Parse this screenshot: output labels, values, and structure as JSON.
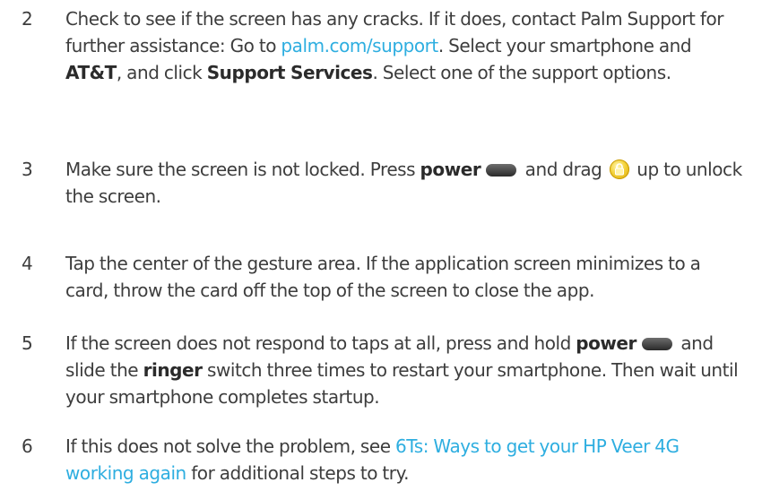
{
  "steps": [
    {
      "number": "2",
      "t1": "Check to see if the screen has any cracks. If it does, contact Palm Support for further assistance: Go to ",
      "link": "palm.com/support",
      "t2": ". Select your smartphone and ",
      "b1": "AT&T",
      "t3": ", and click ",
      "b2": "Support Services",
      "t4": ". Select one of the support options."
    },
    {
      "number": "3",
      "t1": "Make sure the screen is not locked. Press ",
      "b1": "power",
      "t2": " and drag ",
      "t3": " up to unlock the screen."
    },
    {
      "number": "4",
      "t1": "Tap the center of the gesture area. If the application screen minimizes to a card, throw the card off the top of the screen to close the app."
    },
    {
      "number": "5",
      "t1": "If the screen does not respond to taps at all, press and hold ",
      "b1": "power",
      "t2": " and slide the ",
      "b2": "ringer",
      "t3": " switch three times to restart your smartphone. Then wait until your smartphone completes startup."
    },
    {
      "number": "6",
      "t1": "If this does not solve the problem, see ",
      "link": "6Ts: Ways to get your HP Veer 4G working again",
      "t2": " for additional steps to try."
    }
  ],
  "colors": {
    "text": "#3d3d3d",
    "link": "#2eaee0"
  },
  "icons": {
    "power": "power-button-icon",
    "unlock": "unlock-drag-icon"
  }
}
